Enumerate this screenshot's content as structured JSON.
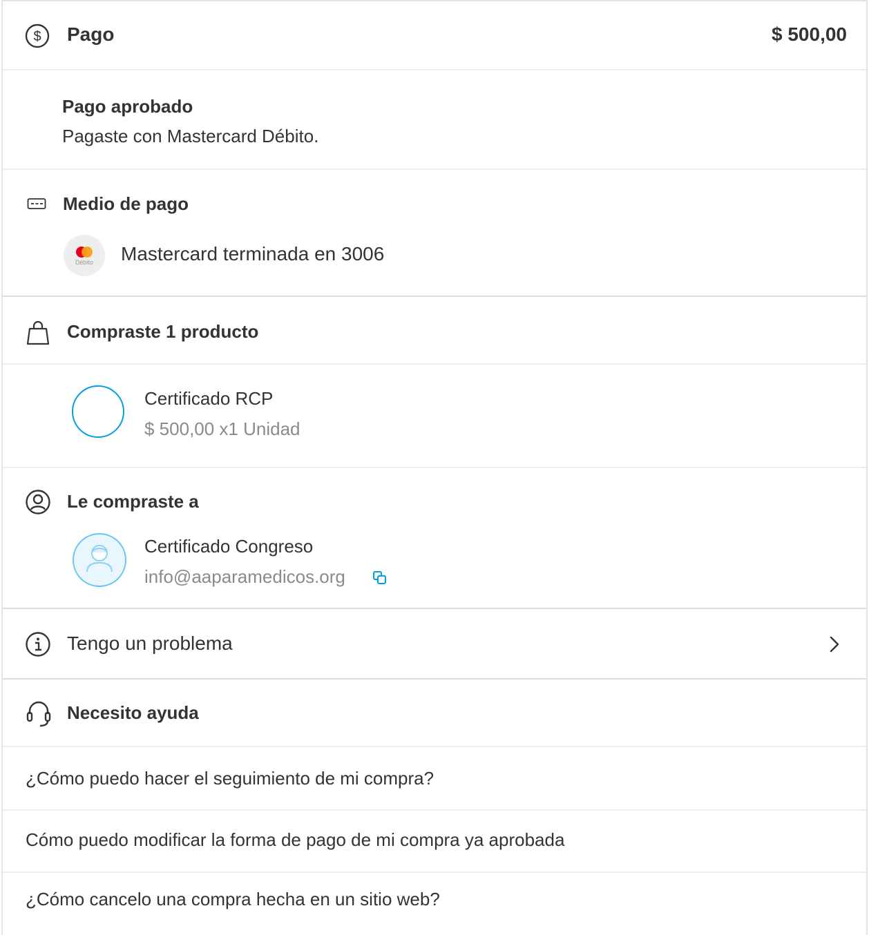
{
  "header": {
    "title": "Pago",
    "amount": "$ 500,00"
  },
  "status": {
    "title": "Pago aprobado",
    "detail": "Pagaste con Mastercard Débito."
  },
  "payment_method": {
    "title": "Medio de pago",
    "badge": "Débito",
    "card_label": "Mastercard terminada en 3006"
  },
  "purchase": {
    "title": "Compraste 1 producto",
    "product_name": "Certificado RCP",
    "product_price": "$ 500,00 x1 Unidad"
  },
  "seller": {
    "title": "Le compraste a",
    "name": "Certificado Congreso",
    "email": "info@aaparamedicos.org"
  },
  "problem": {
    "label": "Tengo un problema"
  },
  "help": {
    "title": "Necesito ayuda",
    "items": [
      "¿Cómo puedo hacer el seguimiento de mi compra?",
      "Cómo puedo modificar la forma de pago de mi compra ya aprobada",
      "¿Cómo cancelo una compra hecha en un sitio web?"
    ]
  },
  "colors": {
    "accent": "#009ee3",
    "text": "#333333",
    "secondary": "#8a8a8a",
    "divider": "#ececec"
  }
}
